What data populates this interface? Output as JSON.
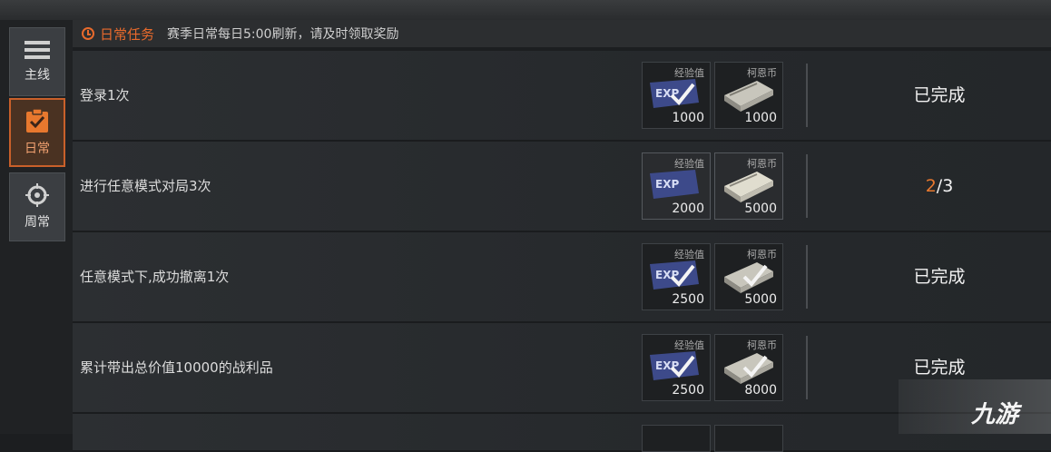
{
  "sidebar": {
    "tabs": [
      {
        "label": "主线",
        "icon": "list-icon"
      },
      {
        "label": "日常",
        "icon": "clipboard-check-icon",
        "active": true
      },
      {
        "label": "周常",
        "icon": "crosshair-icon"
      }
    ]
  },
  "header": {
    "title": "日常任务",
    "description": "赛季日常每日5:00刷新，请及时领取奖励"
  },
  "reward_labels": {
    "exp": "经验值",
    "coin": "柯恩币"
  },
  "tasks": [
    {
      "name": "登录1次",
      "exp": "1000",
      "coin": "1000",
      "status": "已完成"
    },
    {
      "name": "进行任意模式对局3次",
      "exp": "2000",
      "coin": "5000",
      "progress_current": "2",
      "progress_total": "/3"
    },
    {
      "name": "任意模式下,成功撤离1次",
      "exp": "2500",
      "coin": "5000",
      "status": "已完成"
    },
    {
      "name": "累计带出总价值10000的战利品",
      "exp": "2500",
      "coin": "8000",
      "status": "已完成"
    }
  ],
  "watermark": "九游",
  "colors": {
    "accent": "#e86a2c",
    "background": "#1c1e20"
  }
}
